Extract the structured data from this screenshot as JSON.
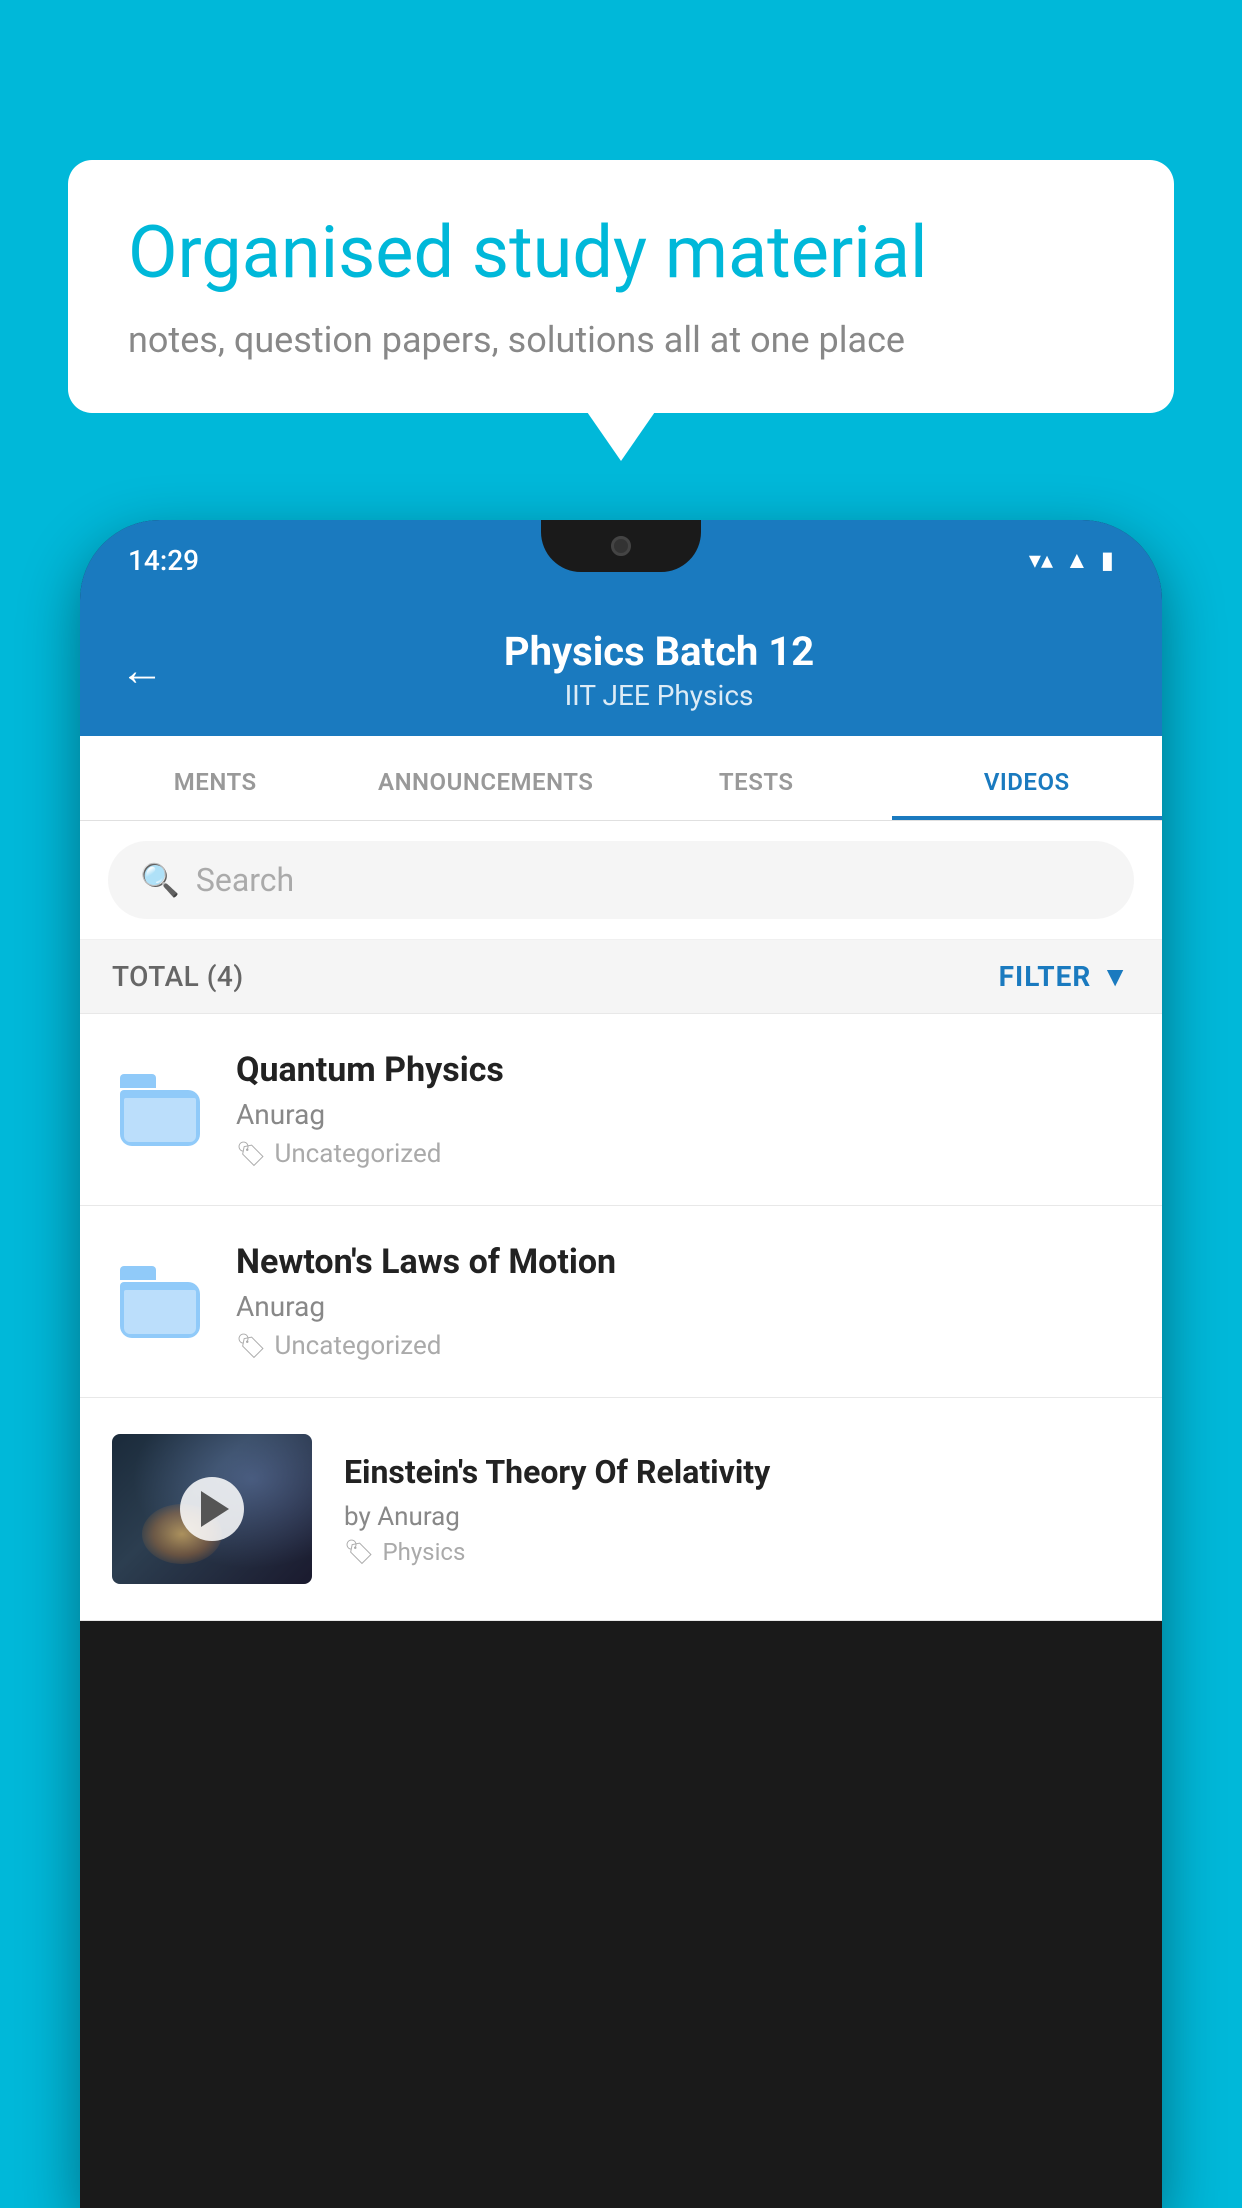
{
  "background_color": "#00b8d9",
  "speech_bubble": {
    "title": "Organised study material",
    "subtitle": "notes, question papers, solutions all at one place"
  },
  "status_bar": {
    "time": "14:29",
    "icons": [
      "wifi",
      "signal",
      "battery"
    ]
  },
  "header": {
    "back_label": "←",
    "title": "Physics Batch 12",
    "subtitle": "IIT JEE   Physics"
  },
  "tabs": [
    {
      "label": "MENTS",
      "active": false
    },
    {
      "label": "ANNOUNCEMENTS",
      "active": false
    },
    {
      "label": "TESTS",
      "active": false
    },
    {
      "label": "VIDEOS",
      "active": true
    }
  ],
  "search": {
    "placeholder": "Search"
  },
  "filter_row": {
    "total_label": "TOTAL (4)",
    "filter_label": "FILTER"
  },
  "video_items": [
    {
      "title": "Quantum Physics",
      "author": "Anurag",
      "tag": "Uncategorized",
      "has_thumbnail": false
    },
    {
      "title": "Newton's Laws of Motion",
      "author": "Anurag",
      "tag": "Uncategorized",
      "has_thumbnail": false
    },
    {
      "title": "Einstein's Theory Of Relativity",
      "author": "by Anurag",
      "tag": "Physics",
      "has_thumbnail": true
    }
  ]
}
